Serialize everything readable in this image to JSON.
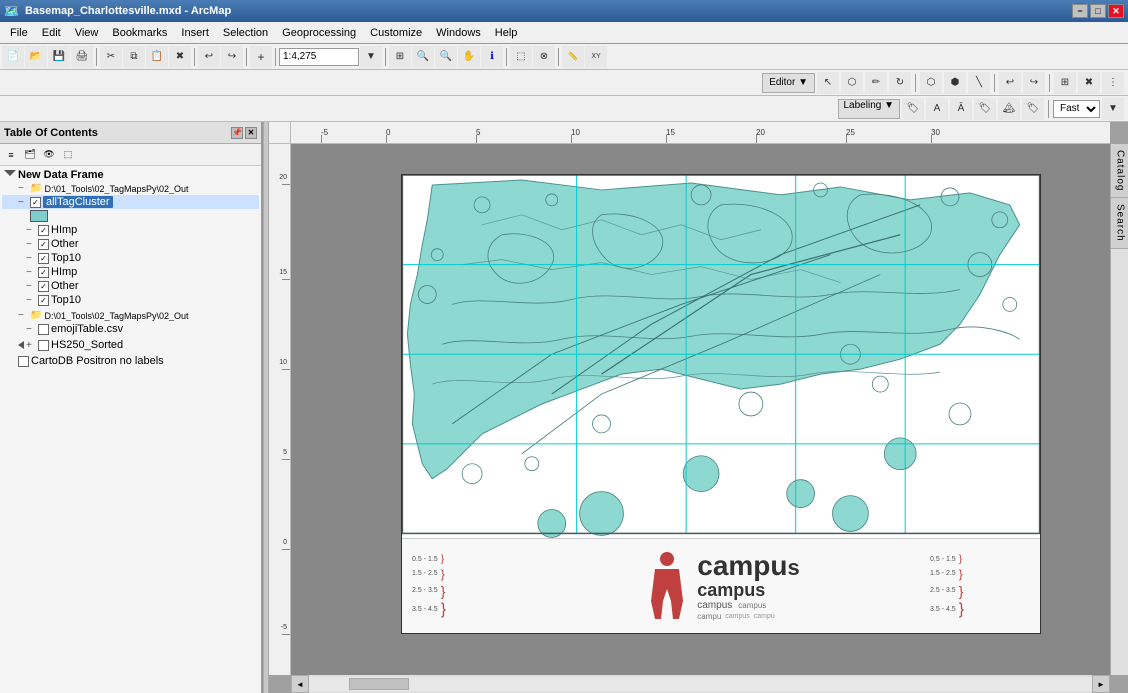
{
  "titleBar": {
    "title": "Basemap_Charlottesville.mxd - ArcMap",
    "minBtn": "−",
    "maxBtn": "□",
    "closeBtn": "✕"
  },
  "menuBar": {
    "items": [
      "File",
      "Edit",
      "View",
      "Bookmarks",
      "Insert",
      "Selection",
      "Geoprocessing",
      "Customize",
      "Windows",
      "Help"
    ]
  },
  "toolbar1": {
    "scale": "1:4,275",
    "scalePlaceholder": "1:4,275"
  },
  "editorToolbar": {
    "editorLabel": "Editor ▼",
    "chevron": "▼"
  },
  "labelingToolbar": {
    "labelingLabel": "Labeling ▼",
    "speedLabel": "Fast",
    "chevron": "▼"
  },
  "toc": {
    "title": "Table Of Contents",
    "pinBtn": "📌",
    "closeBtn": "✕",
    "frames": [
      {
        "name": "New Data Frame",
        "layers": [
          {
            "path": "D:\\01_Tools\\02_TagMapsPy\\02_Out",
            "sublayers": [
              {
                "name": "allTagCluster",
                "checked": true,
                "selected": true,
                "colorBox": {
                  "width": 12,
                  "height": 8,
                  "color": "#7fc8c8"
                }
              }
            ]
          },
          {
            "name": "HImp",
            "checked": true,
            "indent": 1
          },
          {
            "name": "Other",
            "checked": true,
            "indent": 1
          },
          {
            "name": "Top10",
            "checked": true,
            "indent": 1
          },
          {
            "name": "HImp",
            "checked": true,
            "indent": 1
          },
          {
            "name": "Other",
            "checked": true,
            "indent": 1
          },
          {
            "name": "Top10",
            "checked": true,
            "indent": 1
          }
        ]
      },
      {
        "name": "D:\\01_Tools\\02_TagMapsPy\\02_Out",
        "sublayers": [
          {
            "name": "emojiTable.csv",
            "checked": false
          }
        ]
      },
      {
        "name": "HS250_Sorted",
        "checked": false,
        "isGroup": true
      },
      {
        "name": "CartoDB Positron no labels",
        "checked": false
      }
    ]
  },
  "ruler": {
    "hTicks": [
      "-5",
      "0",
      "5",
      "10",
      "15",
      "20",
      "25",
      "30"
    ],
    "vTicks": [
      "20",
      "15",
      "10",
      "5",
      "0",
      "-5"
    ]
  },
  "rightPanel": {
    "tabs": [
      "Catalog",
      "Search"
    ]
  },
  "tagMapText": {
    "campusLarge": "campu",
    "campusMedium": "campus",
    "campusSmall1": "campus",
    "campusSmall2": "campus",
    "campusSmall3": "campu",
    "campusSmall4": "campus",
    "campusSmall5": "campu"
  }
}
